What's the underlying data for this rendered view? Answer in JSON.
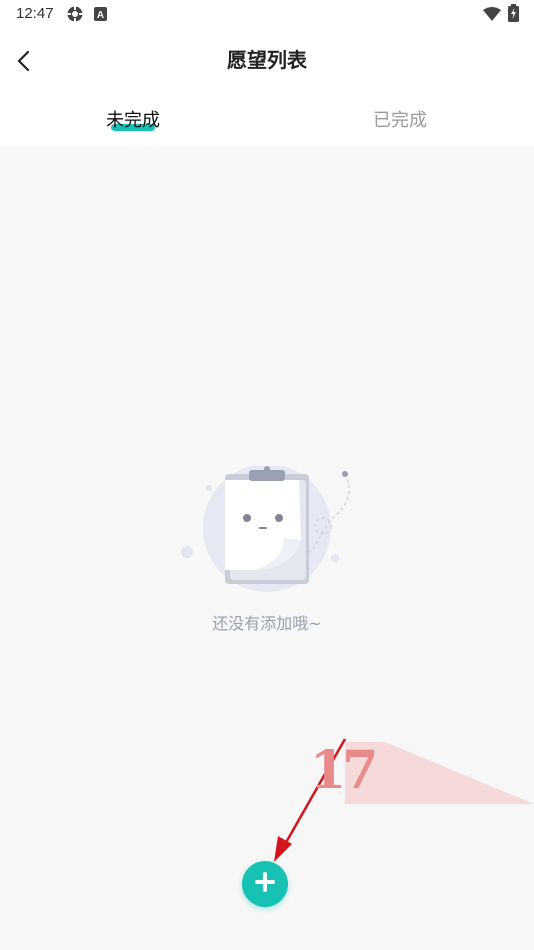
{
  "status_bar": {
    "time": "12:47",
    "icons": [
      "settings-gear-icon",
      "a-notification-icon",
      "wifi-icon",
      "battery-charging-icon"
    ]
  },
  "header": {
    "title": "愿望列表",
    "back_icon": "chevron-left-icon"
  },
  "tabs": [
    {
      "label": "未完成",
      "active": true
    },
    {
      "label": "已完成",
      "active": false
    }
  ],
  "empty_state": {
    "message": "还没有添加哦~",
    "illustration": "clipboard-face-illustration"
  },
  "fab": {
    "icon": "plus-icon"
  },
  "colors": {
    "accent": "#17c2b4",
    "background": "#f7f7f7",
    "muted_text": "#9aa1ad",
    "annotation_arrow": "#d0161c"
  },
  "watermark": {
    "text": "17"
  }
}
